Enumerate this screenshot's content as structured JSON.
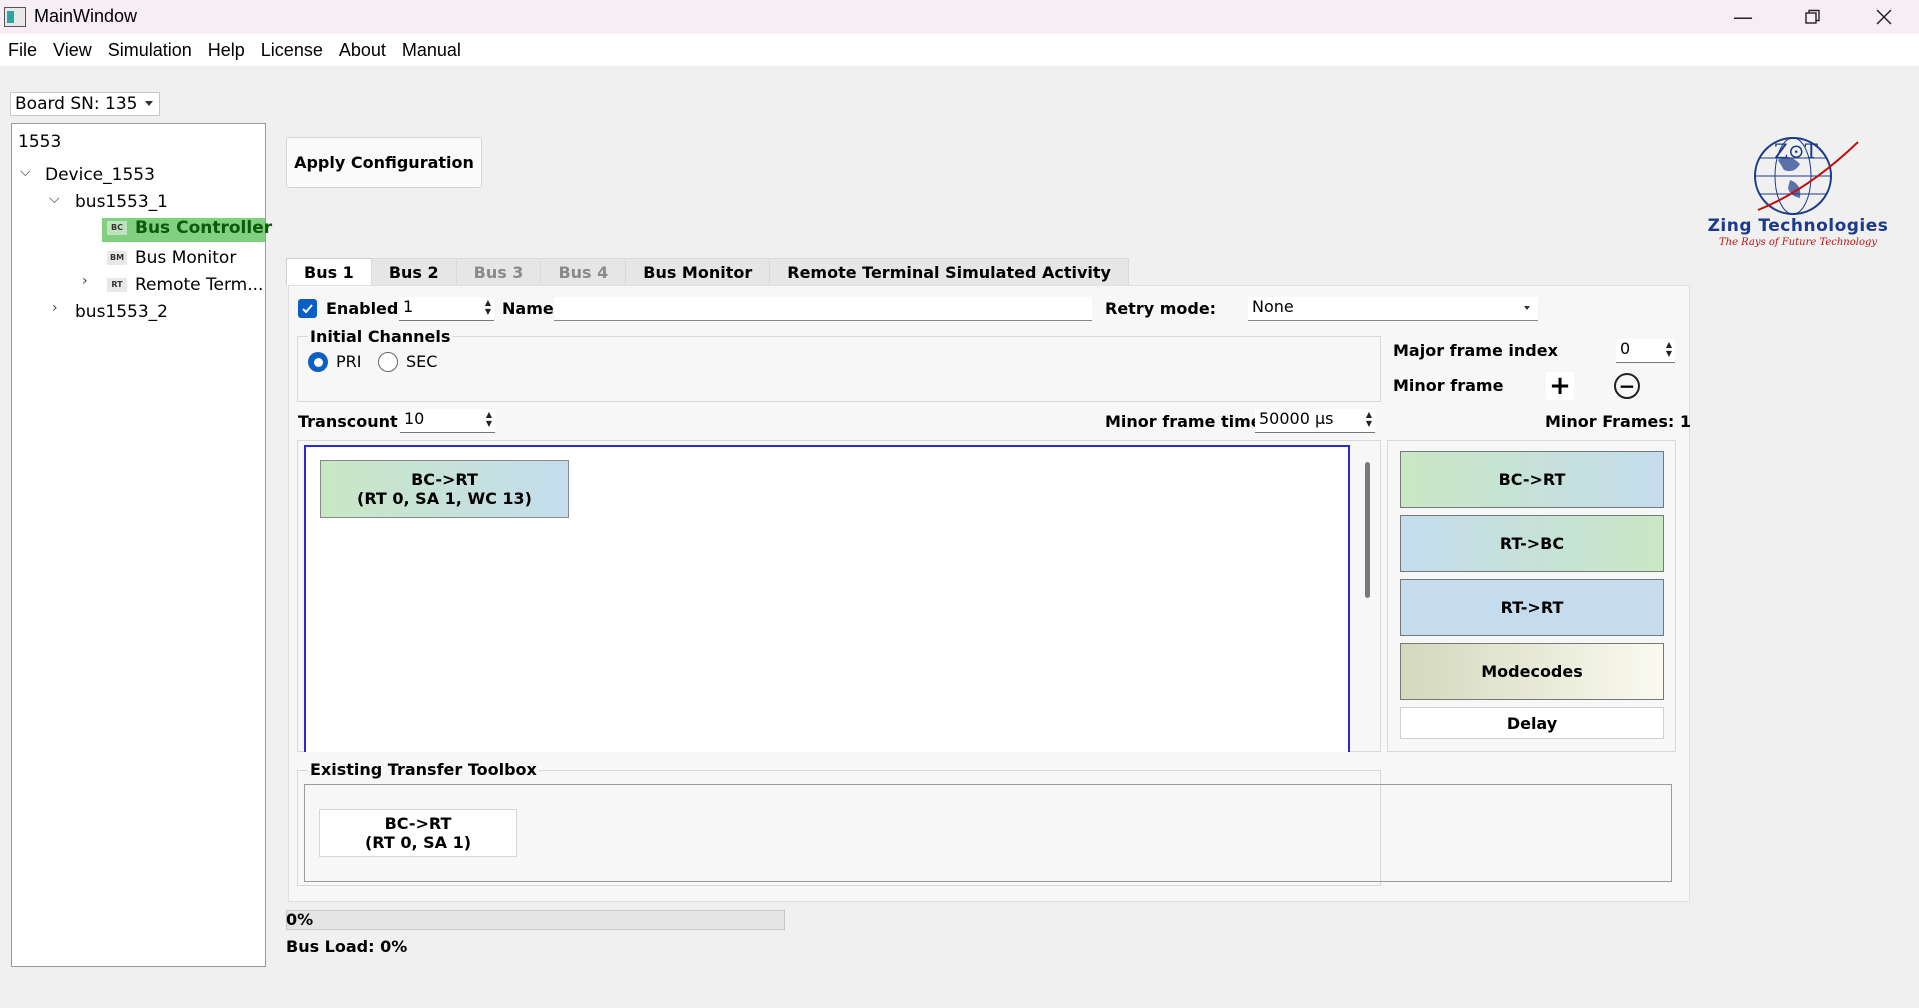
{
  "window": {
    "title": "MainWindow",
    "minimize_icon": "minimize-icon",
    "restore_icon": "restore-icon",
    "close_icon": "close-icon"
  },
  "menu": [
    "File",
    "View",
    "Simulation",
    "Help",
    "License",
    "About",
    "Manual"
  ],
  "board": {
    "label": "Board SN: 135"
  },
  "tree": {
    "root": "1553",
    "device": "Device_1553",
    "bus1": "bus1553_1",
    "bc_badge": "BC",
    "bc": "Bus Controller",
    "bm_badge": "BM",
    "bm": "Bus Monitor",
    "rt_badge": "RT",
    "rt": "Remote Term...",
    "bus2": "bus1553_2"
  },
  "apply_button": "Apply Configuration",
  "logo": {
    "letters": "Z⊙T",
    "name": "Zing Technologies",
    "tagline": "The Rays of Future Technology"
  },
  "tabs": [
    {
      "label": "Bus 1",
      "state": "active"
    },
    {
      "label": "Bus 2",
      "state": "normal"
    },
    {
      "label": "Bus 3",
      "state": "disabled"
    },
    {
      "label": "Bus 4",
      "state": "disabled"
    },
    {
      "label": "Bus Monitor",
      "state": "normal"
    },
    {
      "label": "Remote Terminal Simulated Activity",
      "state": "normal"
    }
  ],
  "bus": {
    "enabled_label": "Enabled",
    "enabled_value": "1",
    "name_label": "Name",
    "name_value": "",
    "retry_label": "Retry mode:",
    "retry_value": "None",
    "initial_channels_label": "Initial Channels",
    "pri_label": "PRI",
    "sec_label": "SEC",
    "major_frame_label": "Major frame index",
    "major_frame_value": "0",
    "minor_frame_label": "Minor frame",
    "transcount_label": "Transcount",
    "transcount_value": "10",
    "minor_time_label": "Minor frame time",
    "minor_time_value": "50000 µs",
    "minor_frames_label": "Minor Frames: 1"
  },
  "canvas_transfer": {
    "line1": "BC->RT",
    "line2": "(RT 0, SA 1, WC 13)"
  },
  "palette": [
    "BC->RT",
    "RT->BC",
    "RT->RT",
    "Modecodes",
    "Delay"
  ],
  "toolbox": {
    "label": "Existing Transfer Toolbox",
    "item_line1": "BC->RT",
    "item_line2": "(RT 0, SA 1)"
  },
  "progress": {
    "text": "0%",
    "value": 0
  },
  "bus_load": "Bus Load: 0%",
  "colors": {
    "selection": "#7fd07f",
    "canvas_border": "#2a2ad0",
    "radio": "#0a5fc4"
  }
}
